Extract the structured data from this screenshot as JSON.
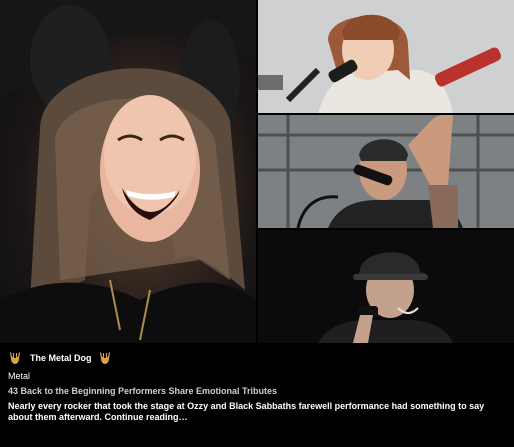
{
  "images": [
    {
      "alt_name": "ozzy-osbourne-photo"
    },
    {
      "alt_name": "female-vocalist-photo"
    },
    {
      "alt_name": "male-vocalist-photo"
    },
    {
      "alt_name": "drummer-photo"
    }
  ],
  "source": {
    "name": "The Metal Dog",
    "icon": "devil-horns-icon",
    "icon_color": "#d9a441"
  },
  "category": "Metal",
  "headline": "43 Back to the Beginning Performers Share Emotional Tributes",
  "summary": "Nearly every rocker that took the stage at Ozzy and Black Sabbaths farewell performance had something to say about them afterward. Continue reading…"
}
